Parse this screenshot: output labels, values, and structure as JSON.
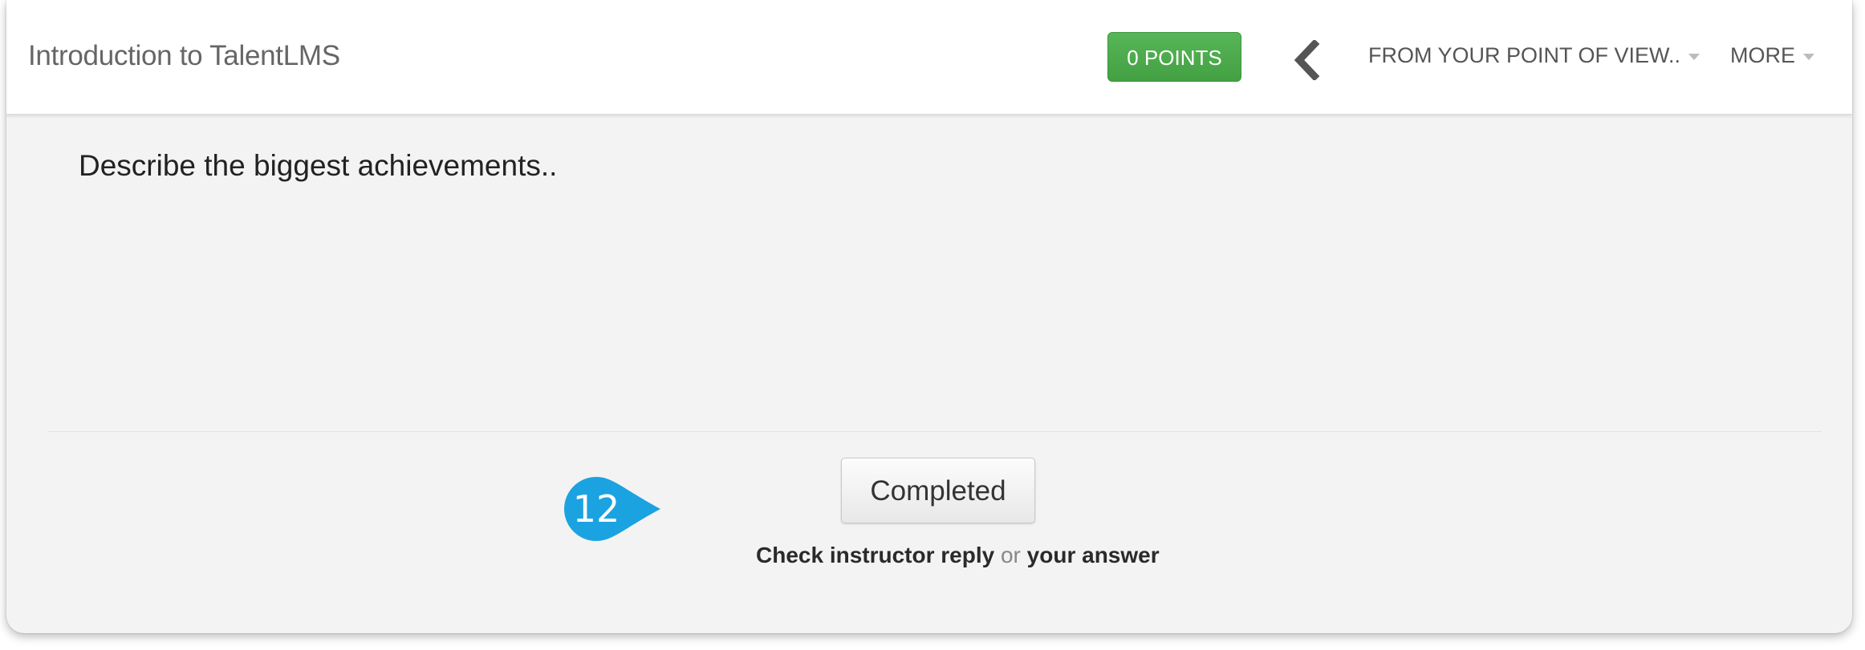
{
  "header": {
    "course_title": "Introduction to TalentLMS",
    "points_badge": "0 POINTS",
    "back_icon": "chevron-left-icon",
    "unit_dropdown_label": "FROM YOUR POINT OF VIEW..",
    "more_dropdown_label": "MORE"
  },
  "main": {
    "question_text": "Describe the biggest achievements..",
    "completed_button_label": "Completed",
    "check_instructor_reply_link": "Check instructor reply",
    "or_text": "or",
    "your_answer_link": "your answer"
  },
  "annotation": {
    "step_number": "12",
    "color": "#1aa3e0"
  },
  "colors": {
    "points_badge": "#4caf50",
    "background": "#f3f3f3",
    "header": "#ffffff"
  }
}
